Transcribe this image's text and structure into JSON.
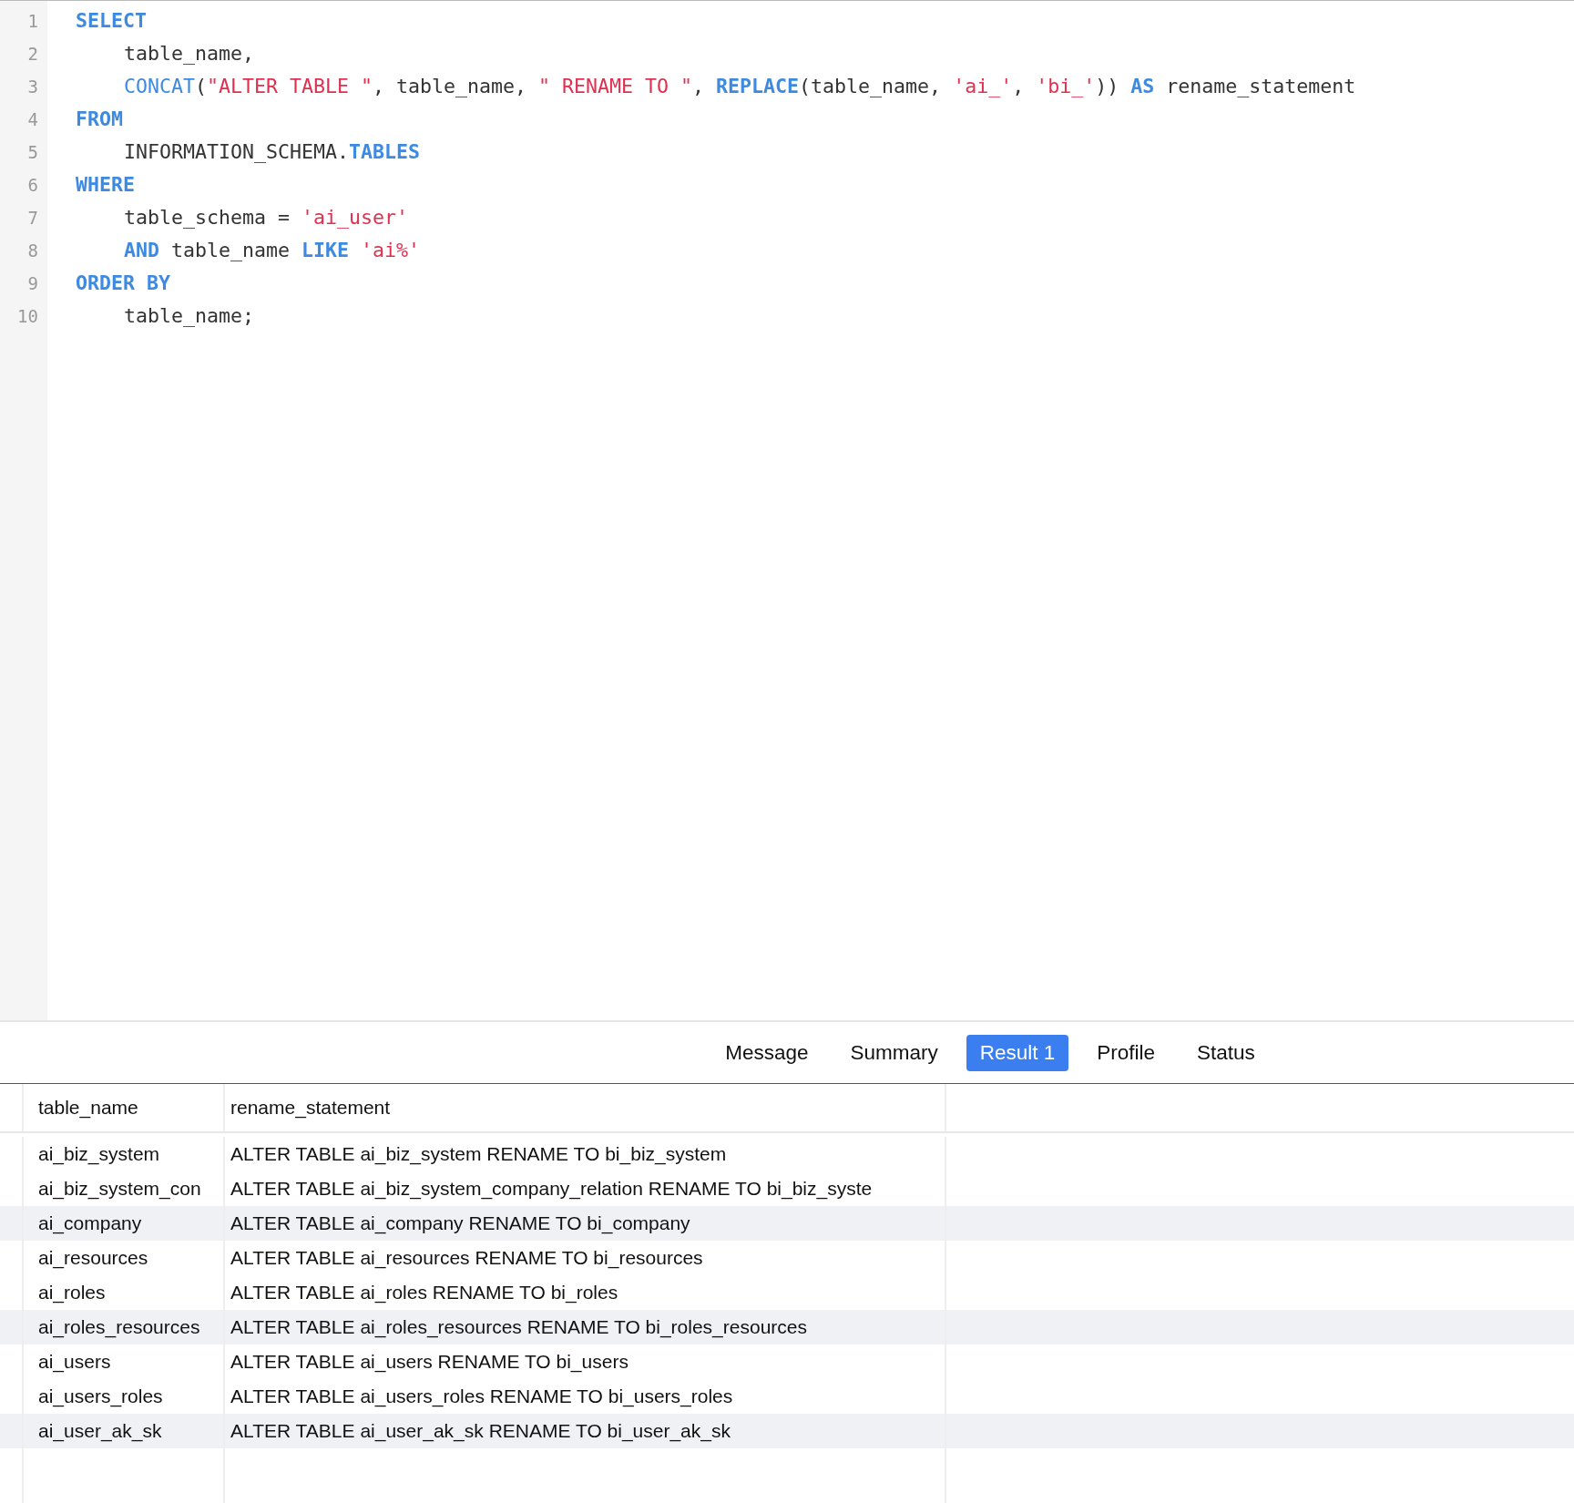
{
  "editor": {
    "lines": [
      {
        "number": "1",
        "indent": false,
        "tokens": [
          {
            "text": "SELECT",
            "kind": "keyword"
          }
        ]
      },
      {
        "number": "2",
        "indent": true,
        "tokens": [
          {
            "text": "table_name,",
            "kind": "plain"
          }
        ]
      },
      {
        "number": "3",
        "indent": true,
        "tokens": [
          {
            "text": "CONCAT",
            "kind": "function"
          },
          {
            "text": "(",
            "kind": "plain"
          },
          {
            "text": "\"ALTER TABLE \"",
            "kind": "string"
          },
          {
            "text": ", table_name, ",
            "kind": "plain"
          },
          {
            "text": "\" RENAME TO \"",
            "kind": "string"
          },
          {
            "text": ", ",
            "kind": "plain"
          },
          {
            "text": "REPLACE",
            "kind": "keyword"
          },
          {
            "text": "(table_name, ",
            "kind": "plain"
          },
          {
            "text": "'ai_'",
            "kind": "string"
          },
          {
            "text": ", ",
            "kind": "plain"
          },
          {
            "text": "'bi_'",
            "kind": "string"
          },
          {
            "text": ")) ",
            "kind": "plain"
          },
          {
            "text": "AS",
            "kind": "keyword"
          },
          {
            "text": " rename_statement",
            "kind": "plain"
          }
        ]
      },
      {
        "number": "4",
        "indent": false,
        "tokens": [
          {
            "text": "FROM",
            "kind": "keyword"
          }
        ]
      },
      {
        "number": "5",
        "indent": true,
        "tokens": [
          {
            "text": "INFORMATION_SCHEMA.",
            "kind": "plain"
          },
          {
            "text": "TABLES",
            "kind": "keyword"
          }
        ]
      },
      {
        "number": "6",
        "indent": false,
        "tokens": [
          {
            "text": "WHERE",
            "kind": "keyword"
          }
        ]
      },
      {
        "number": "7",
        "indent": true,
        "tokens": [
          {
            "text": "table_schema = ",
            "kind": "plain"
          },
          {
            "text": "'ai_user'",
            "kind": "string"
          }
        ]
      },
      {
        "number": "8",
        "indent": true,
        "tokens": [
          {
            "text": "AND",
            "kind": "keyword"
          },
          {
            "text": " table_name ",
            "kind": "plain"
          },
          {
            "text": "LIKE",
            "kind": "keyword"
          },
          {
            "text": " 'ai%'",
            "kind": "string"
          }
        ]
      },
      {
        "number": "9",
        "indent": false,
        "tokens": [
          {
            "text": "ORDER BY",
            "kind": "keyword"
          }
        ]
      },
      {
        "number": "10",
        "indent": true,
        "tokens": [
          {
            "text": "table_name;",
            "kind": "plain"
          }
        ]
      }
    ]
  },
  "tabs": [
    {
      "label": "Message",
      "selected": false
    },
    {
      "label": "Summary",
      "selected": false
    },
    {
      "label": "Result 1",
      "selected": true
    },
    {
      "label": "Profile",
      "selected": false
    },
    {
      "label": "Status",
      "selected": false
    }
  ],
  "table": {
    "columns": [
      "table_name",
      "rename_statement"
    ],
    "rows": [
      {
        "cells": [
          "ai_biz_system",
          "ALTER TABLE ai_biz_system RENAME TO bi_biz_system"
        ],
        "highlighted": false
      },
      {
        "cells": [
          "ai_biz_system_con",
          "ALTER TABLE ai_biz_system_company_relation RENAME TO bi_biz_syste"
        ],
        "highlighted": false
      },
      {
        "cells": [
          "ai_company",
          "ALTER TABLE ai_company RENAME TO bi_company"
        ],
        "highlighted": true
      },
      {
        "cells": [
          "ai_resources",
          "ALTER TABLE ai_resources RENAME TO bi_resources"
        ],
        "highlighted": false
      },
      {
        "cells": [
          "ai_roles",
          "ALTER TABLE ai_roles RENAME TO bi_roles"
        ],
        "highlighted": false
      },
      {
        "cells": [
          "ai_roles_resources",
          "ALTER TABLE ai_roles_resources RENAME TO bi_roles_resources"
        ],
        "highlighted": true
      },
      {
        "cells": [
          "ai_users",
          "ALTER TABLE ai_users RENAME TO bi_users"
        ],
        "highlighted": false
      },
      {
        "cells": [
          "ai_users_roles",
          "ALTER TABLE ai_users_roles RENAME TO bi_users_roles"
        ],
        "highlighted": false
      },
      {
        "cells": [
          "ai_user_ak_sk",
          "ALTER TABLE ai_user_ak_sk RENAME TO bi_user_ak_sk"
        ],
        "highlighted": true
      }
    ]
  }
}
